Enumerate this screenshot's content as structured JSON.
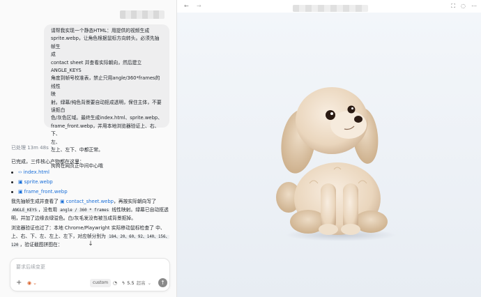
{
  "chat": {
    "title_blurred": "",
    "user_message_lines": [
      "请帮我实现一个静态HTML：用提供的视频生成",
      "sprite.webp，让角色根据鼠标方向转头。必须先抽帧生",
      "成",
      "contact sheet 并查看实际朝向，然后建立ANGLE_KEYS",
      "角度到帧号校准表，禁止只用angle/360*frames的线性",
      "映",
      "射。绿幕/纯色背景要自动抠成透明，保住主体，不要",
      "误抠白",
      "色/灰色区域。最终生成index.html、sprite.webp、",
      "frame_front.webp，并用本地浏览器验证上、右、下、",
      "左、",
      "左上、左下、中都正常。"
    ],
    "user_message_last": "狗狗在网页正中间中心哦",
    "processed_label": "已处理 13m 48s",
    "done_text": "已完成，三件核心产物都在这里：",
    "files": [
      {
        "name": "index.html",
        "icon": "code-icon"
      },
      {
        "name": "sprite.webp",
        "icon": "image-icon"
      },
      {
        "name": "frame_front.webp",
        "icon": "image-icon"
      }
    ],
    "para1": {
      "prefix": "我先抽帧生成并查看了",
      "link": "contact_sheet.webp",
      "middle": "，再按实际朝向写了",
      "code1": "ANGLE_KEYS",
      "text2": "，没有用",
      "code2": "angle / 360 * frames",
      "text3": "线性映射。绿幕已自动抠透明，并加了边缘去绿溢色。白/灰毛发没有被当成背景抠掉。"
    },
    "para2": {
      "prefix": "浏览器验证也过了：本地 Chrome/Playwright 实际移动鼠标检查了 中、上、右、下、左、左上、左下，对应帧分别为",
      "code1": "184、20、60、92、140、156、120",
      "suffix": "，验证截图拼图在："
    },
    "composer": {
      "placeholder": "要求后续变更",
      "custom_label": "custom",
      "model_version": "5.5",
      "model_mode": "超高"
    }
  },
  "preview": {
    "url_blurred": ""
  },
  "colors": {
    "link": "#1a6fd8",
    "permission": "#d9622b",
    "stage_bg": "#eef2f7"
  }
}
